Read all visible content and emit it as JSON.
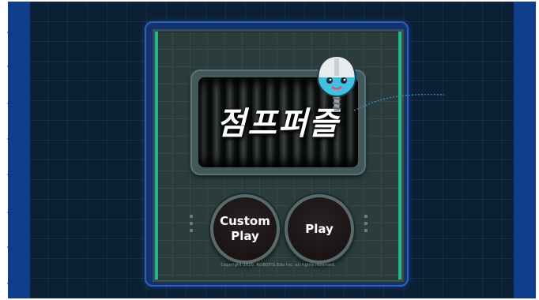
{
  "game": {
    "title": "점프퍼즐",
    "buttons": {
      "custom_play_line1": "Custom",
      "custom_play_line2": "Play",
      "play": "Play"
    },
    "copyright": "Copyright 2020. ROBOTIS.Edu Inc. all rights reserved."
  },
  "colors": {
    "background": "#0b2035",
    "side_bars": "#0f3d8a",
    "panel_border": "#2f60b8",
    "accent_rail": "#27b38c",
    "button_face": "#1b1414"
  },
  "icons": [
    "robot-mascot-icon"
  ]
}
